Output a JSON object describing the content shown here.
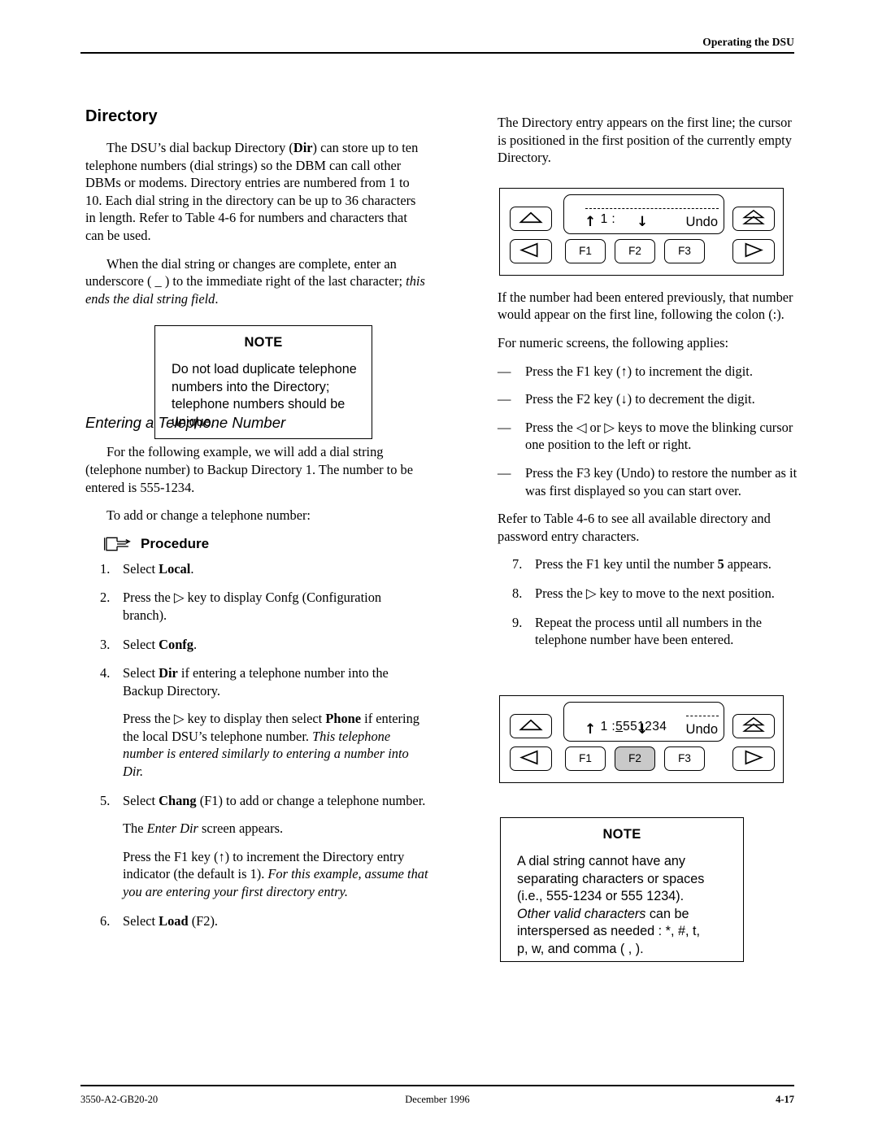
{
  "header": {
    "running_head": "Operating the DSU"
  },
  "footer": {
    "doc_number": "3550-A2-GB20-20",
    "date": "December 1996",
    "page_number": "4-17"
  },
  "left_column": {
    "section_title": "Directory",
    "paragraphs": [
      "The DSU’s dial backup Directory (Dir) can store up to ten telephone numbers (dial strings) so the DBM can call other DBMs or modems. Directory entries are numbered from 1 to 10. Each dial string in the directory can be up to 36 characters in length. Refer to Table 4-6 for numbers and characters that can be used.",
      "When the dial string or changes are complete, enter an underscore ( _ ) to the immediate right of the last character; this ends the dial string field."
    ],
    "note": {
      "title": "NOTE",
      "body": "Do not load duplicate telephone numbers into the Directory; telephone numbers should be unique."
    },
    "subsection_title": "Entering a Telephone Number",
    "subsection_paragraphs": [
      "For the following example, we will add a dial string (telephone number) to Backup Directory 1. The number to be entered is 555-1234.",
      "To add or change a telephone number:"
    ],
    "procedure_label": "Procedure",
    "procedure_icon": "pointing-hand-icon",
    "steps": [
      {
        "number": "1.",
        "text": "Select Local."
      },
      {
        "number": "2.",
        "text": "Press the ▷ key to display Confg (Configuration branch)."
      },
      {
        "number": "3.",
        "text": "Select Confg."
      },
      {
        "number": "4.",
        "text": "Select Dir if entering a telephone number into the Backup Directory.",
        "sub": [
          "Press the ▷ key to display then select Phone if entering the local DSU’s telephone number. This telephone number is entered similarly to entering a number into Dir."
        ]
      },
      {
        "number": "5.",
        "text": "Select Chang (F1) to add or change a telephone number.",
        "sub": [
          "The Enter Dir screen appears.",
          "Press the F1 key (↑) to increment the Directory entry indicator (the default is 1). For this example, assume that you are entering your first directory entry."
        ]
      },
      {
        "number": "6.",
        "text": "Select Load (F2)."
      }
    ]
  },
  "right_column": {
    "intro_paragraph": "The Directory entry appears on the first line; the cursor is positioned in the first position of the currently empty Directory.",
    "paragraphs_after_device1": [
      "If the number had been entered previously, that number would appear on the first line, following the colon (:).",
      "For numeric screens, the following applies:"
    ],
    "dash_items": [
      "Press the F1 key (↑) to increment the digit.",
      "Press the F2 key (↓) to decrement the digit.",
      "Press the ◁ or ▷ keys to move the blinking cursor one position to the left or right.",
      "Press the F3 key (Undo) to restore the number as it was first displayed so you can start over."
    ],
    "refer_paragraph": "Refer to Table 4-6 to see all available directory and password entry characters.",
    "steps": [
      {
        "number": "7.",
        "text": "Press the F1 key until the number 5 appears."
      },
      {
        "number": "8.",
        "text": "Press the ▷ key to move to the next position."
      },
      {
        "number": "9.",
        "text": "Repeat the process until all numbers in the telephone number have been entered."
      }
    ],
    "note": {
      "title": "NOTE",
      "body_lines": [
        "A dial string cannot have any",
        "separating characters or spaces",
        "(i.e., 555-1234 or 555 1234).",
        "Other valid characters can be",
        "interspersed as needed : *, #, t,",
        "p, w, and comma ( , )."
      ]
    }
  },
  "device_panel_1": {
    "lcd_line1_prefix": "1 :",
    "lcd_line1_value": "",
    "lcd_line1_dashes": "- - - - - - - - - -",
    "lcd_up_arrow": "↑",
    "lcd_down_arrow": "↓",
    "lcd_undo_label": "Undo",
    "function_keys": [
      {
        "label": "F1",
        "active": false
      },
      {
        "label": "F2",
        "active": false
      },
      {
        "label": "F3",
        "active": false
      }
    ],
    "arrow_keys": {
      "top_left": "up-arrow-key",
      "bottom_left": "left-arrow-key",
      "top_right": "escape-arrow-key",
      "bottom_right": "right-arrow-key"
    }
  },
  "device_panel_2": {
    "lcd_line1_prefix": "1 :",
    "lcd_line1_value": "5551234",
    "lcd_cursor_digit": "5",
    "lcd_line1_dashes": "- - -",
    "lcd_up_arrow": "↑",
    "lcd_down_arrow": "↓",
    "lcd_undo_label": "Undo",
    "function_keys": [
      {
        "label": "F1",
        "active": false
      },
      {
        "label": "F2",
        "active": true
      },
      {
        "label": "F3",
        "active": false
      }
    ],
    "arrow_keys": {
      "top_left": "up-arrow-key",
      "bottom_left": "left-arrow-key",
      "top_right": "escape-arrow-key",
      "bottom_right": "right-arrow-key"
    }
  },
  "colors": {
    "ink": "#000000",
    "paper": "#ffffff",
    "key_highlight": "#c9c9c9"
  }
}
